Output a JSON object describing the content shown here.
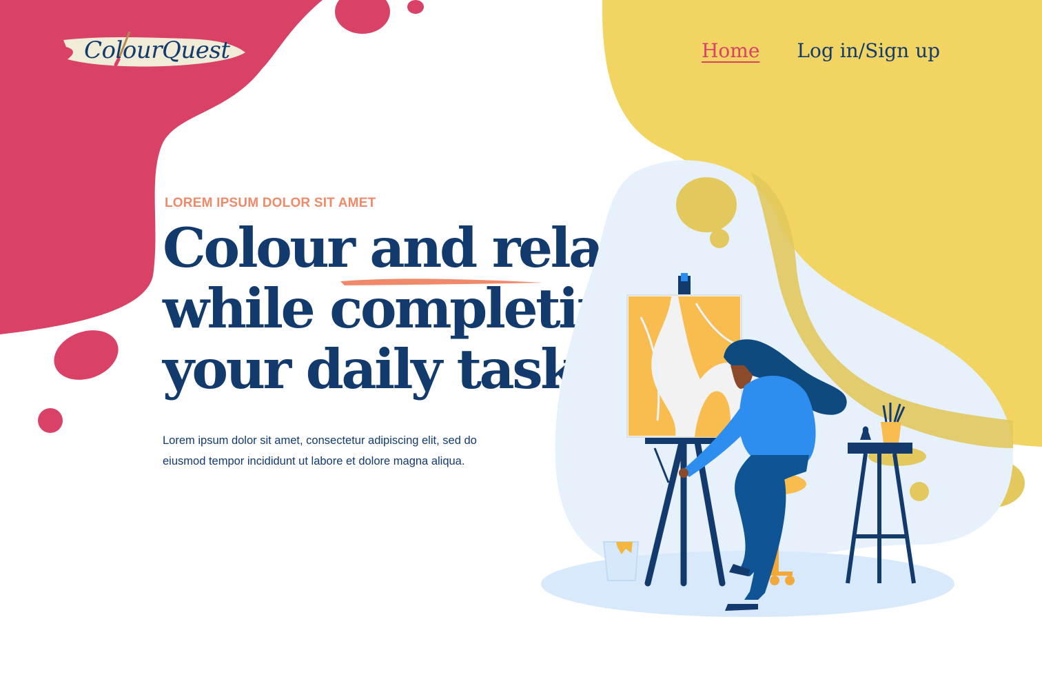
{
  "brand": {
    "logo_text": "ColourQuest",
    "colors": {
      "pink": "#d94266",
      "yellow": "#f2d462",
      "navy": "#123a6d",
      "coral": "#f0896a",
      "light_blue": "#e6f1fc"
    }
  },
  "nav": {
    "items": [
      {
        "label": "Home",
        "active": true
      },
      {
        "label": "Log in/Sign up",
        "active": false
      }
    ]
  },
  "hero": {
    "eyebrow": "LOREM IPSUM DOLOR SIT AMET",
    "headline_lines": [
      "Colour and relax",
      "while completing",
      "your daily tasks"
    ],
    "description": "Lorem ipsum dolor sit amet, consectetur adipiscing elit, sed do eiusmod tempor incididunt ut labore et dolore magna aliqua."
  },
  "illustration": {
    "icon": "woman-painting-at-easel-illustration"
  }
}
